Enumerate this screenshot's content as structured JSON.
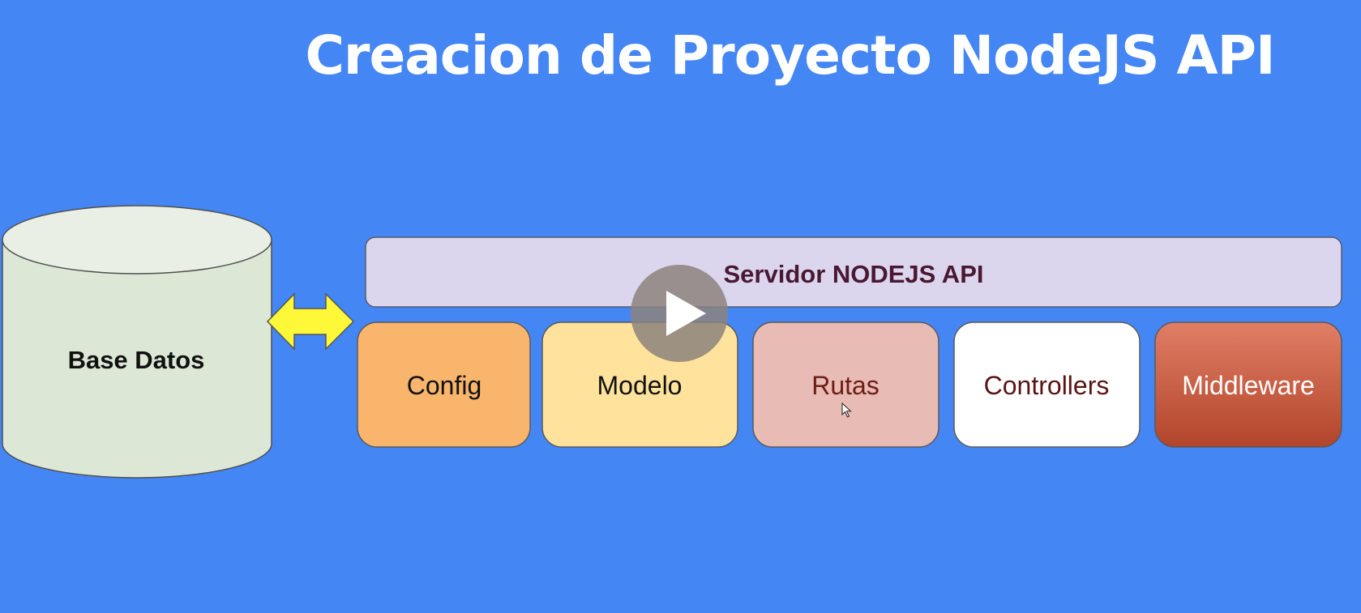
{
  "title": "Creacion de Proyecto NodeJS API",
  "database": {
    "label": "Base Datos",
    "fill": "#dce8d5"
  },
  "server": {
    "label": "Servidor NODEJS API",
    "fill": "#dbd6ed",
    "text_color": "#4a1832"
  },
  "modules": [
    {
      "label": "Config",
      "fill": "#f9b56c",
      "text_color": "#111111"
    },
    {
      "label": "Modelo",
      "fill": "#ffe39c",
      "text_color": "#111111"
    },
    {
      "label": "Rutas",
      "fill": "#e8bbb4",
      "text_color": "#6b1d16"
    },
    {
      "label": "Controllers",
      "fill": "#ffffff",
      "text_color": "#5a1414"
    },
    {
      "label": "Middleware",
      "fill": "#c95a3e",
      "text_color": "#ffffff"
    }
  ],
  "connector": {
    "icon": "double-arrow-icon",
    "fill": "#fef838"
  },
  "overlay": {
    "play_icon": "play-icon",
    "cursor_icon": "mouse-pointer-icon"
  },
  "background": "#4586f5"
}
